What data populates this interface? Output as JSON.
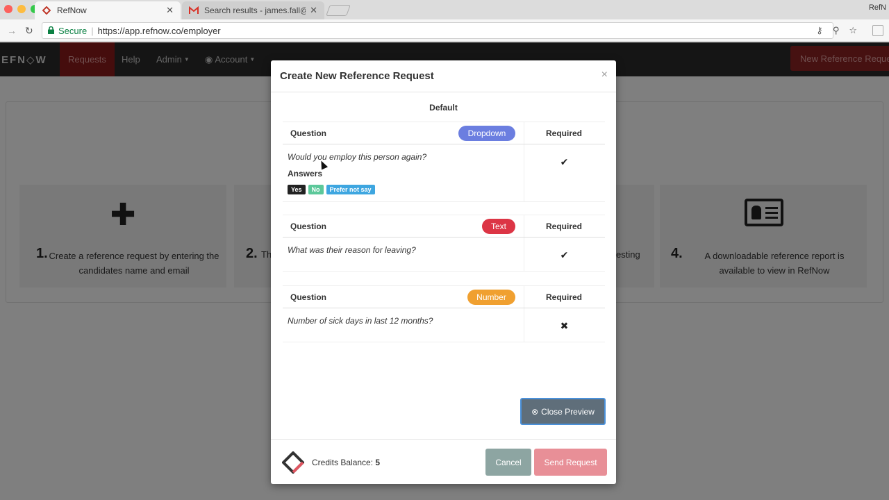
{
  "browser": {
    "tabs": [
      {
        "title": "RefNow"
      },
      {
        "title": "Search results - james.fall@ref"
      }
    ],
    "profile": "RefN",
    "secure_label": "Secure",
    "url": "https://app.refnow.co/employer"
  },
  "app": {
    "logo": "EFN◇W",
    "nav": {
      "requests": "Requests",
      "help": "Help",
      "admin": "Admin",
      "account": "Account"
    },
    "new_request_button": "New Reference Reques"
  },
  "steps": [
    {
      "num": "1.",
      "text": "Create a reference request by entering the candidates name and email"
    },
    {
      "num": "2.",
      "text": "Th"
    },
    {
      "num": "",
      "text": "esting"
    },
    {
      "num": "4.",
      "text": "A downloadable reference report is available to view in RefNow"
    }
  ],
  "modal": {
    "title": "Create New Reference Request",
    "close": "×",
    "preview_title": "Default",
    "questions": [
      {
        "header": "Question",
        "type": "Dropdown",
        "type_color": "#6b7ee0",
        "required_header": "Required",
        "text": "Would you employ this person again?",
        "answers_label": "Answers",
        "answers": [
          {
            "label": "Yes",
            "color": "#222222"
          },
          {
            "label": "No",
            "color": "#5cc89a"
          },
          {
            "label": "Prefer not say",
            "color": "#3ea6e0"
          }
        ],
        "required_mark": "✔"
      },
      {
        "header": "Question",
        "type": "Text",
        "type_color": "#dc3545",
        "required_header": "Required",
        "text": "What was their reason for leaving?",
        "required_mark": "✔"
      },
      {
        "header": "Question",
        "type": "Number",
        "type_color": "#f0a030",
        "required_header": "Required",
        "text": "Number of sick days in last 12 months?",
        "required_mark": "✖"
      }
    ],
    "close_preview": "Close Preview",
    "credits_label": "Credits Balance:",
    "credits_value": "5",
    "cancel": "Cancel",
    "send": "Send Request"
  }
}
